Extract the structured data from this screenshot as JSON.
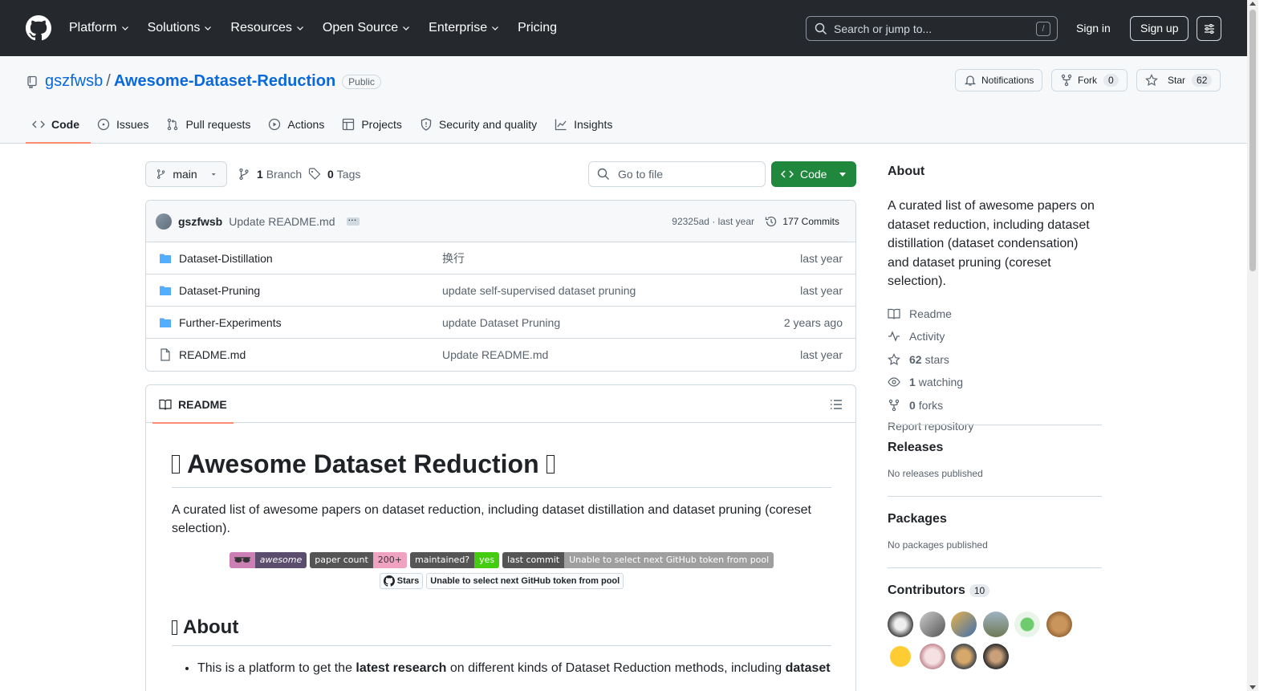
{
  "header": {
    "nav": [
      "Platform",
      "Solutions",
      "Resources",
      "Open Source",
      "Enterprise",
      "Pricing"
    ],
    "search_placeholder": "Search or jump to...",
    "search_key": "/",
    "sign_in": "Sign in",
    "sign_up": "Sign up"
  },
  "repo": {
    "owner": "gszfwsb",
    "sep": "/",
    "name": "Awesome-Dataset-Reduction",
    "visibility": "Public",
    "notifications": "Notifications",
    "fork_label": "Fork",
    "fork_count": "0",
    "star_label": "Star",
    "star_count": "62"
  },
  "tabs": [
    "Code",
    "Issues",
    "Pull requests",
    "Actions",
    "Projects",
    "Security and quality",
    "Insights"
  ],
  "toolbar": {
    "branch": "main",
    "branch_count": "1",
    "branch_label": "Branch",
    "tag_count": "0",
    "tag_label": "Tags",
    "go_to_file": "Go to file",
    "code_button": "Code"
  },
  "commit": {
    "author": "gszfwsb",
    "message": "Update README.md",
    "hash": "92325ad · last year",
    "commits": "177 Commits"
  },
  "files": [
    {
      "name": "Dataset-Distillation",
      "type": "folder",
      "message": "换行",
      "time": "last year"
    },
    {
      "name": "Dataset-Pruning",
      "type": "folder",
      "message": "update self-supervised dataset pruning",
      "time": "last year"
    },
    {
      "name": "Further-Experiments",
      "type": "folder",
      "message": "update Dataset Pruning",
      "time": "2 years ago"
    },
    {
      "name": "README.md",
      "type": "file",
      "message": "Update README.md",
      "time": "last year"
    }
  ],
  "readme": {
    "tab": "README",
    "title": "Awesome Dataset Reduction",
    "intro": "A curated list of awesome papers on dataset reduction, including dataset distillation and dataset pruning (coreset selection).",
    "badges": [
      {
        "left": "awesome",
        "right": ""
      },
      {
        "left": "paper count",
        "right": "200+"
      },
      {
        "left": "maintained?",
        "right": "yes"
      },
      {
        "left": "last commit",
        "right": "Unable to select next GitHub token from pool"
      }
    ],
    "stars_badge": "Stars",
    "stars_badge_msg": "Unable to select next GitHub token from pool",
    "h2": "About",
    "bullet_a": "This is a platform to get the ",
    "bullet_b": "latest research",
    "bullet_c": " on different kinds of Dataset Reduction methods, including ",
    "bullet_d": "dataset"
  },
  "about": {
    "title": "About",
    "description": "A curated list of awesome papers on dataset reduction, including dataset distillation (dataset condensation) and dataset pruning (coreset selection).",
    "readme": "Readme",
    "activity": "Activity",
    "stars_n": "62",
    "stars": "stars",
    "watching_n": "1",
    "watching": "watching",
    "forks_n": "0",
    "forks": "forks",
    "report": "Report repository"
  },
  "releases": {
    "title": "Releases",
    "sub": "No releases published"
  },
  "packages": {
    "title": "Packages",
    "sub": "No packages published"
  },
  "contributors": {
    "title": "Contributors",
    "count": "10"
  },
  "colors": {
    "accent": "#0969da",
    "green": "#1f883d",
    "header": "#25292e",
    "tab_underline": "#fd8c73"
  }
}
